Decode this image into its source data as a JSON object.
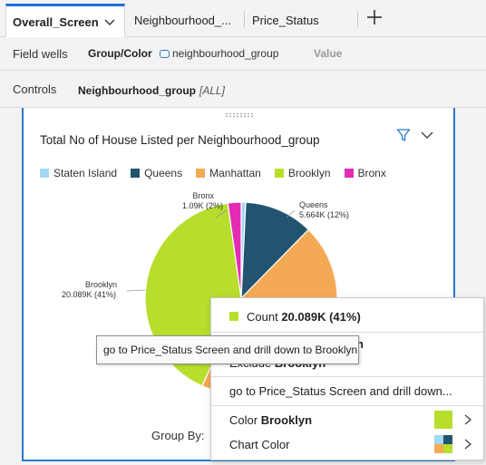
{
  "tabs": [
    {
      "label": "Overall_Screen",
      "active": true
    },
    {
      "label": "Neighbourhood_...",
      "active": false
    },
    {
      "label": "Price_Status",
      "active": false
    }
  ],
  "field_wells": {
    "label": "Field wells",
    "group_key": "Group/Color",
    "group_value": "neighbourhood_group",
    "value_key": "Value"
  },
  "controls": {
    "label": "Controls",
    "name": "Neighbourhood_group",
    "value": "[ALL]"
  },
  "visual": {
    "title": "Total No of House Listed per Neighbourhood_group",
    "group_by_label": "Group By:"
  },
  "chart_data": {
    "type": "pie",
    "title": "Total No of House Listed per Neighbourhood_group",
    "legend_position": "top",
    "slices": [
      {
        "name": "Staten Island",
        "value": 373,
        "percent": 1,
        "color": "#a5d8f3"
      },
      {
        "name": "Queens",
        "value": 5664,
        "percent": 12,
        "label": "Queens",
        "value_label": "5.664K (12%)",
        "color": "#225470"
      },
      {
        "name": "Manhattan",
        "value": 21661,
        "percent": 44,
        "color": "#f4a955"
      },
      {
        "name": "Brooklyn",
        "value": 20089,
        "percent": 41,
        "label": "Brooklyn",
        "value_label": "20.089K (41%)",
        "color": "#b8de2d"
      },
      {
        "name": "Bronx",
        "value": 1090,
        "percent": 2,
        "label": "Bronx",
        "value_label": "1.09K (2%)",
        "color": "#e52bb4"
      }
    ]
  },
  "context_menu": {
    "count_label": "Count",
    "count_value": "20.089K (41%)",
    "focus_tail": "n",
    "exclude_label": "Exclude",
    "exclude_value": "Brooklyn",
    "drill_label": "go to Price_Status Screen and drill down...",
    "color_label": "Color",
    "color_value": "Brooklyn",
    "chart_color_label": "Chart Color"
  },
  "tooltip": {
    "text": "go to Price_Status Screen and drill down to Brooklyn"
  },
  "colors": {
    "accent": "#1d6fd8",
    "selection_border": "#2b7ac9"
  }
}
